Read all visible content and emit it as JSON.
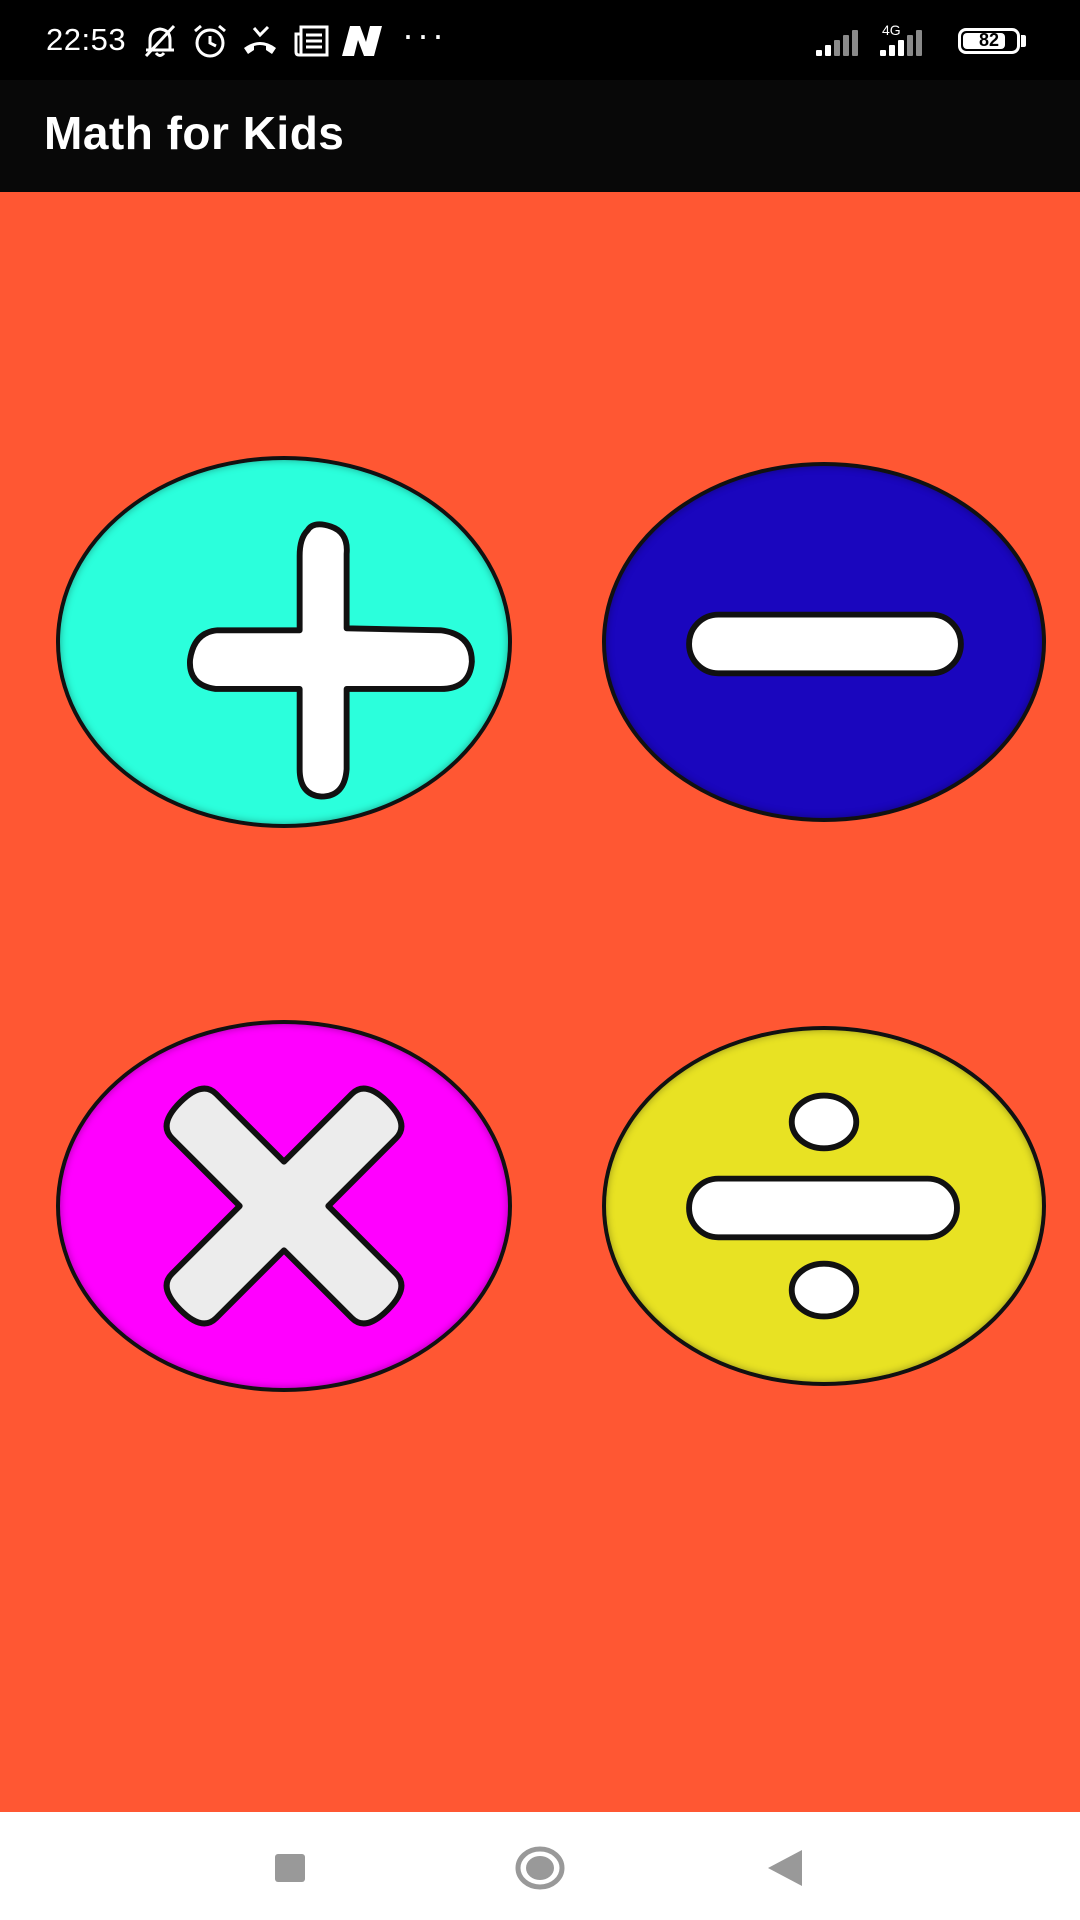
{
  "status_bar": {
    "time": "22:53",
    "network_type": "4G",
    "battery_level": "82",
    "battery_fraction": 0.82,
    "icons": [
      "bell-muted-icon",
      "alarm-icon",
      "missed-call-icon",
      "news-icon",
      "n-app-icon",
      "more-dots-icon",
      "signal-icon",
      "signal-4g-icon",
      "battery-icon"
    ],
    "more": "···"
  },
  "app_bar": {
    "title": "Math for Kids"
  },
  "operations": [
    {
      "name": "addition",
      "icon": "plus-icon",
      "color": "#2bffdc"
    },
    {
      "name": "subtraction",
      "icon": "minus-icon",
      "color": "#1a06be"
    },
    {
      "name": "multiplication",
      "icon": "multiply-icon",
      "color": "#ff00ff"
    },
    {
      "name": "division",
      "icon": "divide-icon",
      "color": "#e8e223"
    }
  ],
  "colors": {
    "background": "#ff5733",
    "app_bar": "#080808",
    "status_bar": "#000000",
    "nav_bar": "#ffffff"
  },
  "nav_bar": {
    "icons": [
      "recents-square-icon",
      "home-circle-icon",
      "back-triangle-icon"
    ]
  }
}
